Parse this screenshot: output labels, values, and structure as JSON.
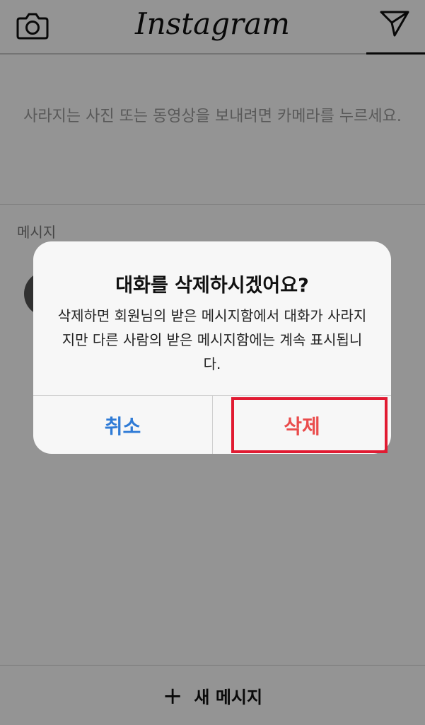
{
  "header": {
    "logo": "Instagram",
    "camera_icon": "camera-icon",
    "send_icon": "paper-plane-icon"
  },
  "hint": {
    "text": "사라지는 사진 또는 동영상을 보내려면 카메라를 누르세요."
  },
  "messages": {
    "section_label": "메시지"
  },
  "footer": {
    "new_message_label": "새 메시지",
    "plus_icon": "+"
  },
  "dialog": {
    "title": "대화를 삭제하시겠어요?",
    "message": "삭제하면 회원님의 받은 메시지함에서 대화가 사라지지만 다른 사람의 받은 메시지함에는 계속 표시됩니다.",
    "cancel_label": "취소",
    "delete_label": "삭제"
  },
  "colors": {
    "cancel": "#2f7bd6",
    "delete": "#ea4c4c",
    "highlight": "#e11b32"
  }
}
